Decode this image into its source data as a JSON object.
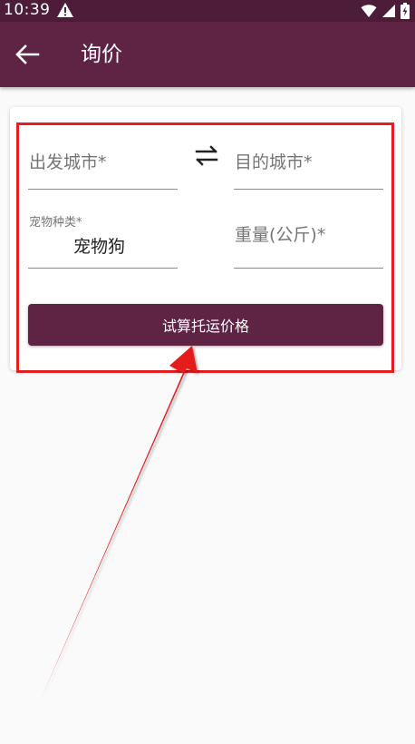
{
  "status_bar": {
    "time": "10:39",
    "icons": [
      "alert-icon",
      "wifi-icon",
      "signal-icon",
      "battery-icon"
    ]
  },
  "app_bar": {
    "title": "询价",
    "back_icon": "back-arrow-icon",
    "color": "#5f2343"
  },
  "form": {
    "departure_city": {
      "placeholder": "出发城市*"
    },
    "destination_city": {
      "placeholder": "目的城市*"
    },
    "pet_type": {
      "label": "宠物种类*",
      "value": "宠物狗"
    },
    "weight": {
      "placeholder": "重量(公斤)*"
    },
    "swap_icon": "swap-horizontal-icon",
    "submit_label": "试算托运价格"
  },
  "annotation": {
    "highlight_color": "#e41f1f"
  },
  "colors": {
    "primary": "#5f2343",
    "status_bar": "#4d1c39",
    "background": "#fafafa"
  }
}
